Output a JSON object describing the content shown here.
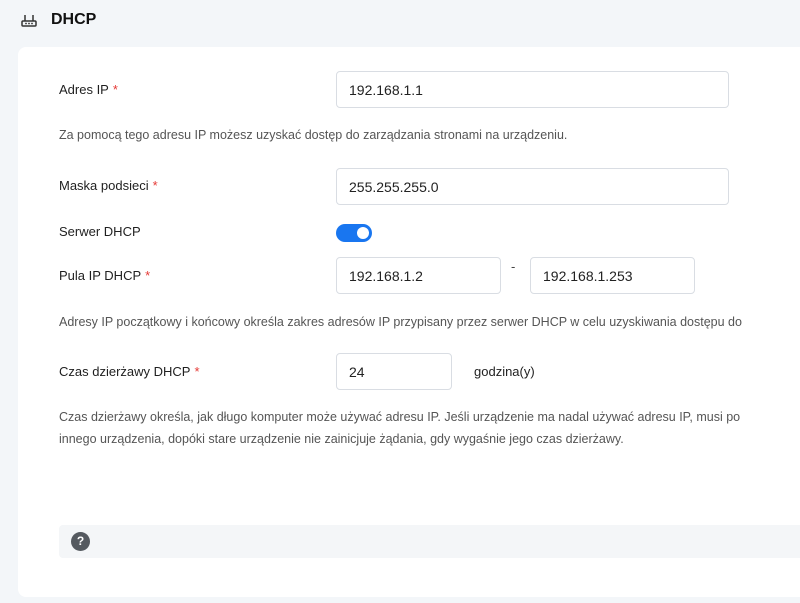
{
  "header": {
    "title": "DHCP",
    "icon": "router-icon"
  },
  "form": {
    "ip_address": {
      "label": "Adres IP",
      "required_mark": "*",
      "value": "192.168.1.1",
      "help": "Za pomocą tego adresu IP możesz uzyskać dostęp do zarządzania stronami na urządzeniu."
    },
    "subnet_mask": {
      "label": "Maska podsieci",
      "required_mark": "*",
      "value": "255.255.255.0"
    },
    "dhcp_server": {
      "label": "Serwer DHCP",
      "enabled": true
    },
    "ip_pool": {
      "label": "Pula IP DHCP",
      "required_mark": "*",
      "start": "192.168.1.2",
      "separator": "-",
      "end": "192.168.1.253",
      "help": "Adresy IP początkowy i końcowy określa zakres adresów IP przypisany przez serwer DHCP w celu uzyskiwania dostępu do"
    },
    "lease_time": {
      "label": "Czas dzierżawy DHCP",
      "required_mark": "*",
      "value": "24",
      "unit": "godzina(y)",
      "help_line1": "Czas dzierżawy określa, jak długo komputer może używać adresu IP. Jeśli urządzenie ma nadal używać adresu IP, musi po",
      "help_line2": "innego urządzenia, dopóki stare urządzenie nie zainicjuje żądania, gdy wygaśnie jego czas dzierżawy."
    }
  },
  "footer": {
    "help_icon_glyph": "?",
    "help_icon": "question-circle-icon"
  },
  "colors": {
    "accent": "#1976f0",
    "required": "#e53935",
    "background": "#f3f6f9"
  }
}
